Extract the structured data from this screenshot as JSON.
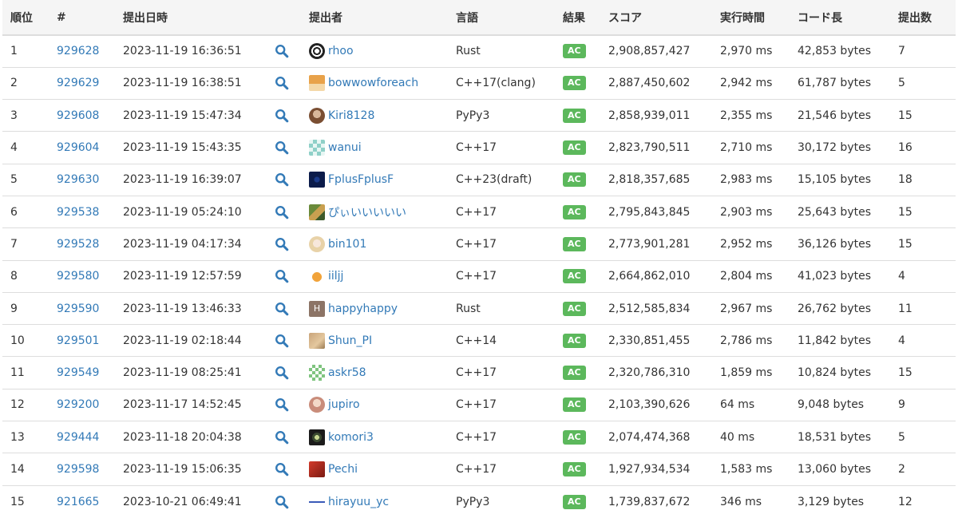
{
  "colors": {
    "link": "#337ab7",
    "ac": "#5cb85c",
    "header_bg": "#f5f5f5",
    "border": "#dddddd"
  },
  "headers": [
    "順位",
    "#",
    "提出日時",
    "",
    "提出者",
    "言語",
    "結果",
    "スコア",
    "実行時間",
    "コード長",
    "提出数"
  ],
  "rows": [
    {
      "rank": "1",
      "id": "929628",
      "date": "2023-11-19 16:36:51",
      "user": "rhoo",
      "avatar": "spiral",
      "lang": "Rust",
      "result": "AC",
      "score": "2,908,857,427",
      "time": "2,970 ms",
      "length": "42,853 bytes",
      "count": "7"
    },
    {
      "rank": "2",
      "id": "929629",
      "date": "2023-11-19 16:38:51",
      "user": "bowwowforeach",
      "avatar": "dog",
      "lang": "C++17(clang)",
      "result": "AC",
      "score": "2,887,450,602",
      "time": "2,942 ms",
      "length": "61,787 bytes",
      "count": "5"
    },
    {
      "rank": "3",
      "id": "929608",
      "date": "2023-11-19 15:47:34",
      "user": "Kiri8128",
      "avatar": "brown-face",
      "lang": "PyPy3",
      "result": "AC",
      "score": "2,858,939,011",
      "time": "2,355 ms",
      "length": "21,546 bytes",
      "count": "15"
    },
    {
      "rank": "4",
      "id": "929604",
      "date": "2023-11-19 15:43:35",
      "user": "wanui",
      "avatar": "teal-grid",
      "lang": "C++17",
      "result": "AC",
      "score": "2,823,790,511",
      "time": "2,710 ms",
      "length": "30,172 bytes",
      "count": "16"
    },
    {
      "rank": "5",
      "id": "929630",
      "date": "2023-11-19 16:39:07",
      "user": "FplusFplusF",
      "avatar": "navy",
      "lang": "C++23(draft)",
      "result": "AC",
      "score": "2,818,357,685",
      "time": "2,983 ms",
      "length": "15,105 bytes",
      "count": "18"
    },
    {
      "rank": "6",
      "id": "929538",
      "date": "2023-11-19 05:24:10",
      "user": "ぴぃいいいいい",
      "avatar": "anime-green",
      "lang": "C++17",
      "result": "AC",
      "score": "2,795,843,845",
      "time": "2,903 ms",
      "length": "25,643 bytes",
      "count": "15"
    },
    {
      "rank": "7",
      "id": "929528",
      "date": "2023-11-19 04:17:34",
      "user": "bin101",
      "avatar": "anime-pale",
      "lang": "C++17",
      "result": "AC",
      "score": "2,773,901,281",
      "time": "2,952 ms",
      "length": "36,126 bytes",
      "count": "15"
    },
    {
      "rank": "8",
      "id": "929580",
      "date": "2023-11-19 12:57:59",
      "user": "iiljj",
      "avatar": "orange-cat",
      "lang": "C++17",
      "result": "AC",
      "score": "2,664,862,010",
      "time": "2,804 ms",
      "length": "41,023 bytes",
      "count": "4"
    },
    {
      "rank": "9",
      "id": "929590",
      "date": "2023-11-19 13:46:33",
      "user": "happyhappy",
      "avatar": "letter-h",
      "avatar_letter": "H",
      "lang": "Rust",
      "result": "AC",
      "score": "2,512,585,834",
      "time": "2,967 ms",
      "length": "26,762 bytes",
      "count": "11"
    },
    {
      "rank": "10",
      "id": "929501",
      "date": "2023-11-19 02:18:44",
      "user": "Shun_PI",
      "avatar": "tan",
      "lang": "C++14",
      "result": "AC",
      "score": "2,330,851,455",
      "time": "2,786 ms",
      "length": "11,842 bytes",
      "count": "4"
    },
    {
      "rank": "11",
      "id": "929549",
      "date": "2023-11-19 08:25:41",
      "user": "askr58",
      "avatar": "green-grid",
      "lang": "C++17",
      "result": "AC",
      "score": "2,320,786,310",
      "time": "1,859 ms",
      "length": "10,824 bytes",
      "count": "15"
    },
    {
      "rank": "12",
      "id": "929200",
      "date": "2023-11-17 14:52:45",
      "user": "jupiro",
      "avatar": "anime-pink",
      "lang": "C++17",
      "result": "AC",
      "score": "2,103,390,626",
      "time": "64 ms",
      "length": "9,048 bytes",
      "count": "9"
    },
    {
      "rank": "13",
      "id": "929444",
      "date": "2023-11-18 20:04:38",
      "user": "komori3",
      "avatar": "dark-circle",
      "lang": "C++17",
      "result": "AC",
      "score": "2,074,474,368",
      "time": "40 ms",
      "length": "18,531 bytes",
      "count": "5"
    },
    {
      "rank": "14",
      "id": "929598",
      "date": "2023-11-19 15:06:35",
      "user": "Pechi",
      "avatar": "red",
      "lang": "C++17",
      "result": "AC",
      "score": "1,927,934,534",
      "time": "1,583 ms",
      "length": "13,060 bytes",
      "count": "2"
    },
    {
      "rank": "15",
      "id": "921665",
      "date": "2023-10-21 06:49:41",
      "user": "hirayuu_yc",
      "avatar": "blue-streak",
      "lang": "PyPy3",
      "result": "AC",
      "score": "1,739,837,672",
      "time": "346 ms",
      "length": "3,129 bytes",
      "count": "12"
    }
  ]
}
